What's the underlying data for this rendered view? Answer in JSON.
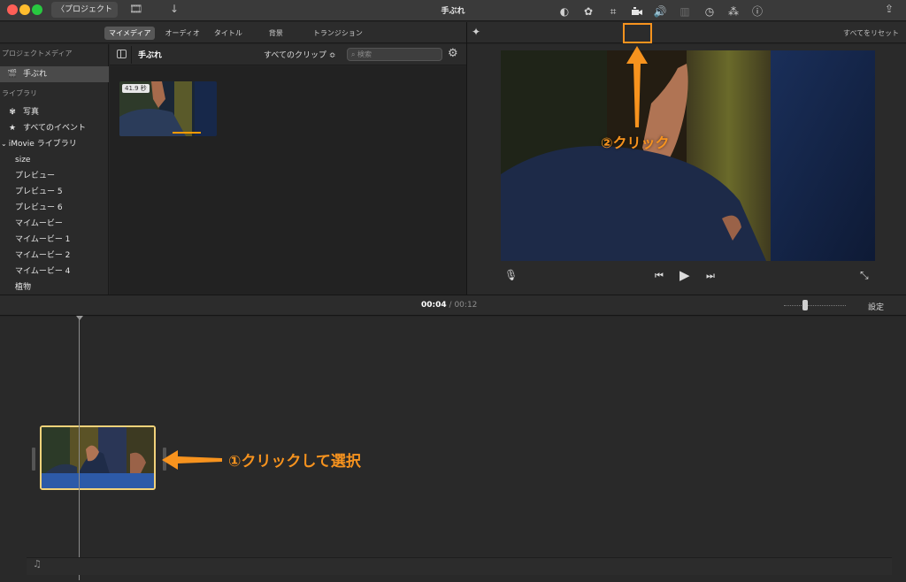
{
  "titlebar": {
    "back_label": "〈プロジェクト",
    "title": "手ぶれ"
  },
  "toolbar": {
    "tabs": [
      "マイメディア",
      "オーディオ",
      "タイトル",
      "背景",
      "トランジション"
    ],
    "active_tab": 0,
    "reset_all": "すべてをリセット",
    "tools": [
      "color-balance-icon",
      "color-correction-icon",
      "crop-icon",
      "stabilization-icon",
      "volume-icon",
      "noise-reduction-icon",
      "speed-icon",
      "clip-filter-icon",
      "info-icon"
    ]
  },
  "sidebar": {
    "section_project_media": "プロジェクトメディア",
    "project_item": "手ぶれ",
    "section_library": "ライブラリ",
    "photos": "写真",
    "all_events": "すべてのイベント",
    "imovie_library": "iMovie ライブラリ",
    "items": [
      "size",
      "プレビュー",
      "プレビュー 5",
      "プレビュー 6",
      "マイムービー",
      "マイムービー 1",
      "マイムービー 2",
      "マイムービー 4",
      "植物"
    ]
  },
  "browser": {
    "title": "手ぶれ",
    "clips_filter": "すべてのクリップ ≎",
    "search_placeholder": "検索",
    "thumb_duration": "41.9 秒"
  },
  "timeline": {
    "current_time": "00:04",
    "separator": "/",
    "total_time": "00:12",
    "settings": "設定"
  },
  "annotations": {
    "step1": "①クリックして選択",
    "step2": "②クリック",
    "color": "#f7931e"
  }
}
